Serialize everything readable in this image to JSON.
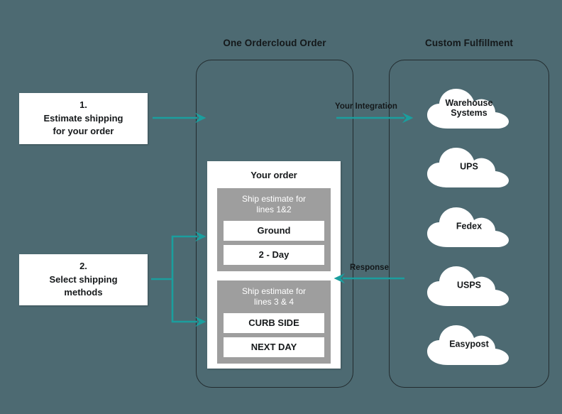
{
  "theme": {
    "background": "#4d6a72",
    "accent_teal": "#1b9e9e",
    "panel_gray": "#9e9e9e",
    "card_white": "#ffffff",
    "border_dark": "#222b2e"
  },
  "groups": {
    "ordercloud": {
      "title": "One Ordercloud Order"
    },
    "fulfillment": {
      "title": "Custom Fulfillment"
    }
  },
  "steps": [
    {
      "num": "1.",
      "line1": "Estimate shipping",
      "line2": "for your order"
    },
    {
      "num": "2.",
      "line1": "Select shipping",
      "line2": "methods"
    }
  ],
  "order_panel": {
    "title": "Your order",
    "estimates": [
      {
        "title_line1": "Ship estimate for",
        "title_line2": "lines 1&2",
        "methods": [
          "Ground",
          "2 - Day"
        ]
      },
      {
        "title_line1": "Ship estimate for",
        "title_line2": "lines 3 & 4",
        "methods": [
          "CURB SIDE",
          "NEXT DAY"
        ]
      }
    ]
  },
  "clouds": [
    {
      "line1": "Warehouse",
      "line2": "Systems"
    },
    {
      "line1": "UPS",
      "line2": ""
    },
    {
      "line1": "Fedex",
      "line2": ""
    },
    {
      "line1": "USPS",
      "line2": ""
    },
    {
      "line1": "Easypost",
      "line2": ""
    }
  ],
  "arrows": {
    "integration_label": "Your Integration",
    "response_label": "Response"
  }
}
